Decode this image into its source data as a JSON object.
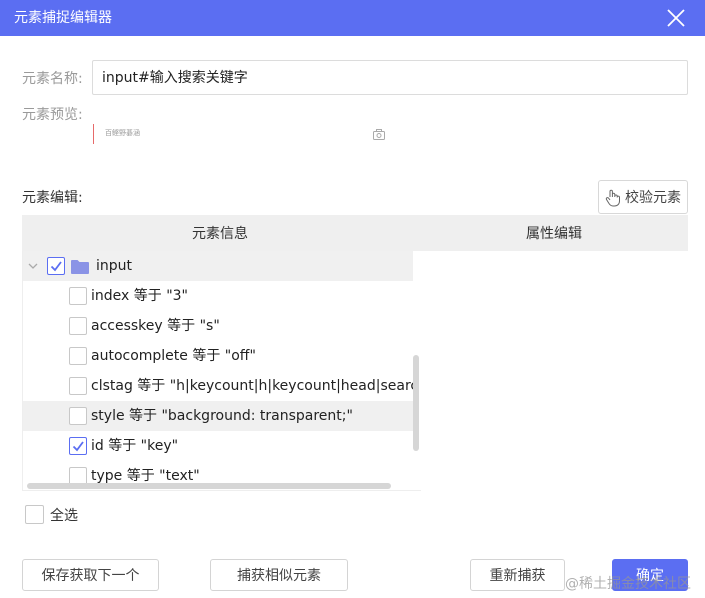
{
  "dialog": {
    "title": "元素捕捉编辑器",
    "accent_color": "#5b6ef2"
  },
  "element_name": {
    "label": "元素名称:",
    "value": "input#输入搜索关键字"
  },
  "element_preview": {
    "label": "元素预览:",
    "placeholder_text": "百鲣野碁涵",
    "icon": "camera-icon"
  },
  "element_edit": {
    "label": "元素编辑:",
    "verify_button": "校验元素",
    "verify_icon": "pointer-hand-icon"
  },
  "table": {
    "col_info": "元素信息",
    "col_props": "属性编辑"
  },
  "tree": {
    "root": {
      "label": "input",
      "checked": true,
      "icon": "folder-icon",
      "expanded": true
    },
    "attributes": [
      {
        "text": "index 等于 \"3\"",
        "checked": false
      },
      {
        "text": "accesskey 等于 \"s\"",
        "checked": false
      },
      {
        "text": "autocomplete 等于 \"off\"",
        "checked": false
      },
      {
        "text": "clstag 等于 \"h|keycount|h|keycount|head|search_",
        "checked": false
      },
      {
        "text": "style 等于 \"background: transparent;\"",
        "checked": false
      },
      {
        "text": "id 等于 \"key\"",
        "checked": true
      },
      {
        "text": "type 等于 \"text\"",
        "checked": false
      }
    ]
  },
  "select_all": {
    "label": "全选",
    "checked": false
  },
  "footer": {
    "save_next": "保存获取下一个",
    "capture_similar": "捕获相似元素",
    "recapture": "重新捕获",
    "confirm": "确定"
  },
  "watermark": "@稀土掘金技术社区"
}
